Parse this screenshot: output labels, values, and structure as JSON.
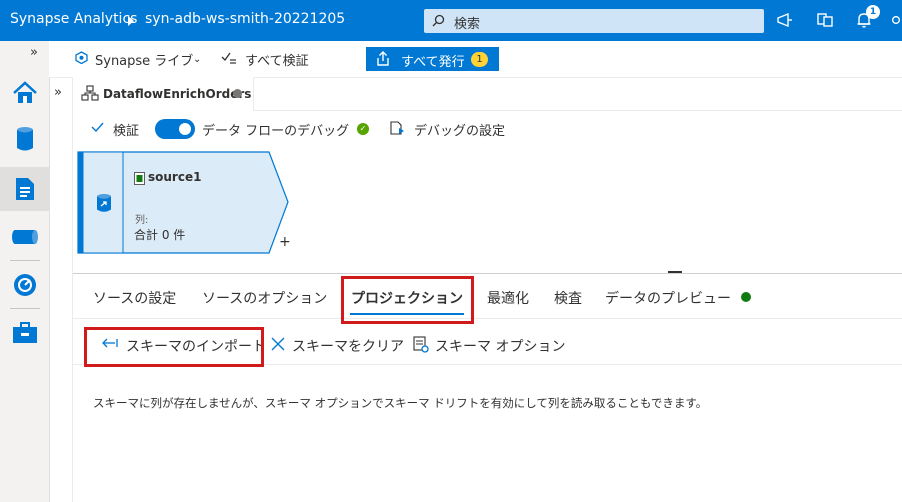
{
  "topbar": {
    "app_title": "Synapse Analytics",
    "workspace": "syn-adb-ws-smith-20221205",
    "search_placeholder": "検索",
    "notification_count": "1",
    "color": "#0078d4"
  },
  "leftnav": {
    "items": [
      "home-icon",
      "data-icon",
      "develop-icon",
      "integrate-icon",
      "monitor-icon",
      "manage-icon"
    ]
  },
  "command_bar": {
    "live_mode_label": "Synapse ライブ",
    "validate_all_label": "すべて検証",
    "publish_all_label": "すべて発行",
    "publish_count": "1"
  },
  "editor_tab": {
    "title": "DataflowEnrichOrders"
  },
  "dataflow_toolbar": {
    "validate_label": "検証",
    "debug_label": "データ フローのデバッグ",
    "debug_settings_label": "デバッグの設定"
  },
  "canvas": {
    "node_name": "source1",
    "columns_label": "列:",
    "total_label": "合計 0 件",
    "add_symbol": "+"
  },
  "panel_tabs": {
    "items": [
      "ソースの設定",
      "ソースのオプション",
      "プロジェクション",
      "最適化",
      "検査",
      "データのプレビュー"
    ],
    "active": "プロジェクション",
    "status_color": "#107c10"
  },
  "projection_actions": {
    "import_schema_label": "スキーマのインポート",
    "clear_schema_label": "スキーマをクリア",
    "schema_options_label": "スキーマ オプション"
  },
  "message": "スキーマに列が存在しませんが、スキーマ オプションでスキーマ ドリフトを有効にして列を読み取ることもできます。"
}
